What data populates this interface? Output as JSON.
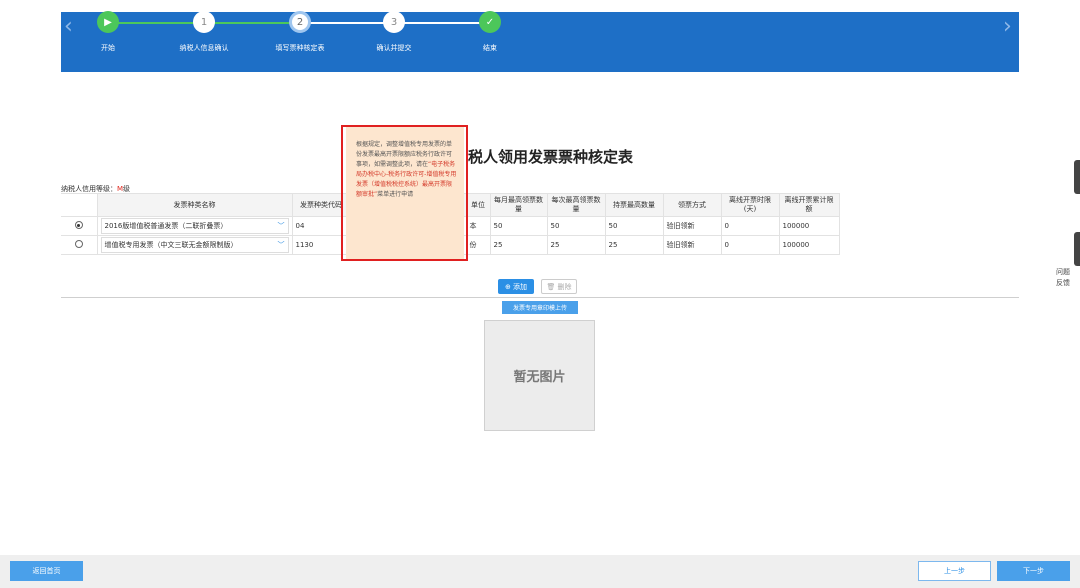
{
  "steps": [
    {
      "label": "开始",
      "marker": "▶",
      "state": "done"
    },
    {
      "label": "纳税人信息确认",
      "marker": "1",
      "state": "todo"
    },
    {
      "label": "填写票种核定表",
      "marker": "2",
      "state": "current"
    },
    {
      "label": "确认并提交",
      "marker": "3",
      "state": "todo"
    },
    {
      "label": "结束",
      "marker": "✓",
      "state": "done"
    }
  ],
  "nav": {
    "prev": "‹",
    "next": "›"
  },
  "title": "税人领用发票票种核定表",
  "credit": {
    "label": "纳税人信用等级：",
    "level": "M",
    "suffix": "级"
  },
  "table": {
    "headers": [
      "发票种类名称",
      "发票种类代码",
      "单位",
      "每月最高领票数量",
      "每次最高领票数量",
      "持票最高数量",
      "领票方式",
      "离线开票时限(天)",
      "离线开票累计限额"
    ],
    "rows": [
      {
        "selected": true,
        "name": "2016版增值税普通发票（二联折叠票）",
        "code": "04",
        "unit": "本",
        "monthly": "50",
        "each": "50",
        "hold": "50",
        "method": "验旧领新",
        "offline_days": "0",
        "offline_limit": "100000"
      },
      {
        "selected": false,
        "name": "增值税专用发票（中文三联无金额限制版）",
        "code": "1130",
        "unit": "份",
        "monthly": "25",
        "each": "25",
        "hold": "25",
        "method": "验旧领新",
        "offline_days": "0",
        "offline_limit": "100000"
      }
    ]
  },
  "tooltip": {
    "text1": "根据规定，调整增值税专用发票的单份发票最高开票限额应税务行政许可事项，如需调整此项，请在",
    "highlight": "“电子税务局办税中心-税务行政许可-增值税专用发票（增值税税控系统）最高开票限额审批”",
    "text2": "菜单进行申请"
  },
  "buttons": {
    "add": "⊕ 添加",
    "delete": "🗑 删除",
    "upload": "发票专用章印模上传",
    "home": "返回首页",
    "prev": "上一步",
    "next": "下一步"
  },
  "no_image": "暂无图片",
  "feedback": "问题反馈",
  "colors": {
    "header": "#1e6fc6",
    "done": "#4cc75a",
    "accent": "#2b8fe5",
    "alert": "#e02020"
  }
}
